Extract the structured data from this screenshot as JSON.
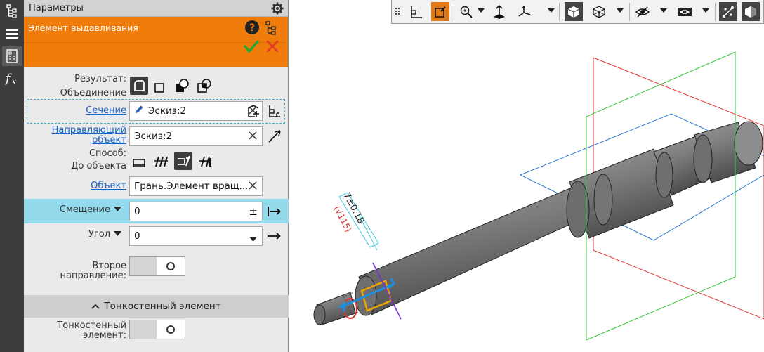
{
  "panel": {
    "title": "Параметры",
    "operation_title": "Элемент выдавливания"
  },
  "fields": {
    "result_label": "Результат:",
    "result_value": "Объединение",
    "section_label": "Сечение",
    "section_value": "Эскиз:2",
    "guide_label_1": "Направляющий",
    "guide_label_2": "объект",
    "guide_value": "Эскиз:2",
    "method_label": "Способ:",
    "method_value": "До объекта",
    "object_label": "Объект",
    "object_value": "Грань.Элемент вращ...",
    "offset_label": "Смещение",
    "offset_value": "0",
    "offset_pm": "±",
    "angle_label": "Угол",
    "angle_value": "0",
    "second_dir_label": "Второе направление:",
    "thin_section_title": "Тонкостенный элемент",
    "thin_label_1": "Тонкостенный",
    "thin_label_2": "элемент:"
  },
  "viewport": {
    "dim_label_1": "7±0.18",
    "dim_label_2": "(√115)"
  },
  "colors": {
    "accent": "#f07d0b",
    "highlight_row": "#93d9ec",
    "link": "#1a62c4",
    "ok": "#2aa534",
    "cancel": "#e23a2a"
  },
  "icons": {
    "strip": [
      "tree-icon",
      "menu-icon",
      "parameters-icon",
      "function-icon"
    ],
    "toolbar": [
      "grip-icon",
      "sketch-icon",
      "edit-sketch-icon",
      "zoom-icon",
      "normal-view-icon",
      "orientation-icon",
      "shaded-icon",
      "wireframe-icon",
      "visibility-icon",
      "hide-icon",
      "points-icon",
      "section-view-icon"
    ]
  }
}
